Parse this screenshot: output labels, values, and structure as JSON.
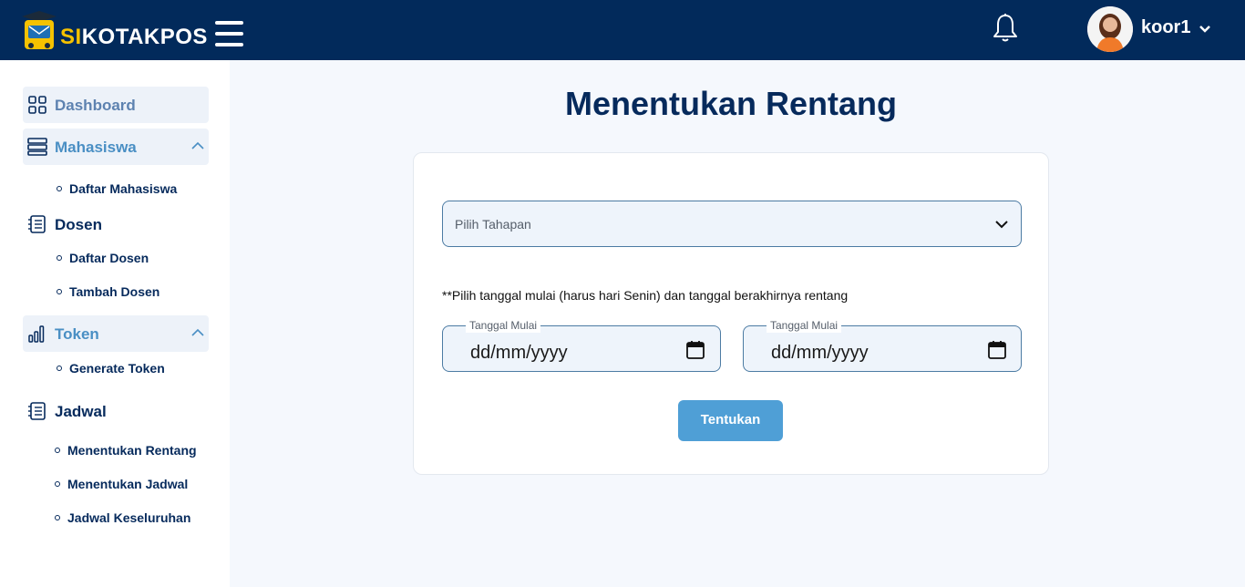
{
  "header": {
    "brand_prefix": "SI",
    "brand_suffix": "KOTAKPOS",
    "username": "koor1",
    "icons": [
      "logo-icon",
      "hamburger-menu-icon",
      "bell-icon",
      "avatar",
      "chevron-down-icon"
    ]
  },
  "sidebar": {
    "dashboard": "Dashboard",
    "mahasiswa": "Mahasiswa",
    "daftar_mahasiswa": "Daftar Mahasiswa",
    "dosen": "Dosen",
    "daftar_dosen": "Daftar Dosen",
    "tambah_dosen": "Tambah Dosen",
    "token": "Token",
    "generate_token": "Generate Token",
    "jadwal": "Jadwal",
    "menentukan_rentang": "Menentukan Rentang",
    "menentukan_jadwal": "Menentukan Jadwal",
    "jadwal_keseluruhan": "Jadwal Keseluruhan"
  },
  "main": {
    "title": "Menentukan Rentang",
    "select_placeholder": "Pilih Tahapan",
    "hint": "**Pilih tanggal mulai (harus hari Senin) dan tanggal berakhirnya rentang",
    "start_label": "Tanggal Mulai",
    "start_value": "dd/mm/yyyy",
    "end_label": "Tanggal Mulai",
    "end_value": "dd/mm/yyyy",
    "submit_label": "Tentukan"
  },
  "colors": {
    "topbar": "#022a5b",
    "brand_accent": "#f6c200",
    "nav_active": "#4a8fc4",
    "primary_text": "#062a5c",
    "button": "#4f9fd6"
  }
}
